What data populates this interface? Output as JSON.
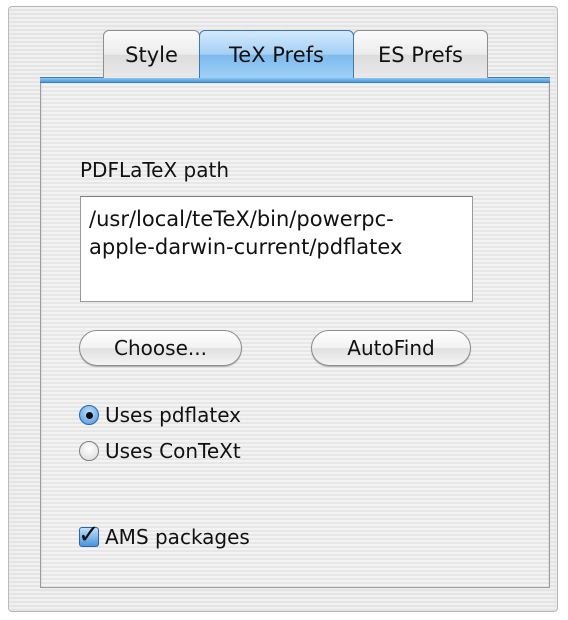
{
  "tabs": [
    {
      "label": "Style",
      "selected": false
    },
    {
      "label": "TeX Prefs",
      "selected": true
    },
    {
      "label": "ES Prefs",
      "selected": false
    }
  ],
  "path_label": "PDFLaTeX path",
  "path_value": "/usr/local/teTeX/bin/powerpc-\napple-darwin-current/pdflatex",
  "buttons": {
    "choose": "Choose...",
    "autofind": "AutoFind"
  },
  "radios": [
    {
      "label": "Uses pdflatex",
      "checked": true
    },
    {
      "label": "Uses ConTeXt",
      "checked": false
    }
  ],
  "checkbox": {
    "label": "AMS packages",
    "checked": true
  },
  "colors": {
    "accent": "#4f98de",
    "window_bg": "#ececec"
  }
}
